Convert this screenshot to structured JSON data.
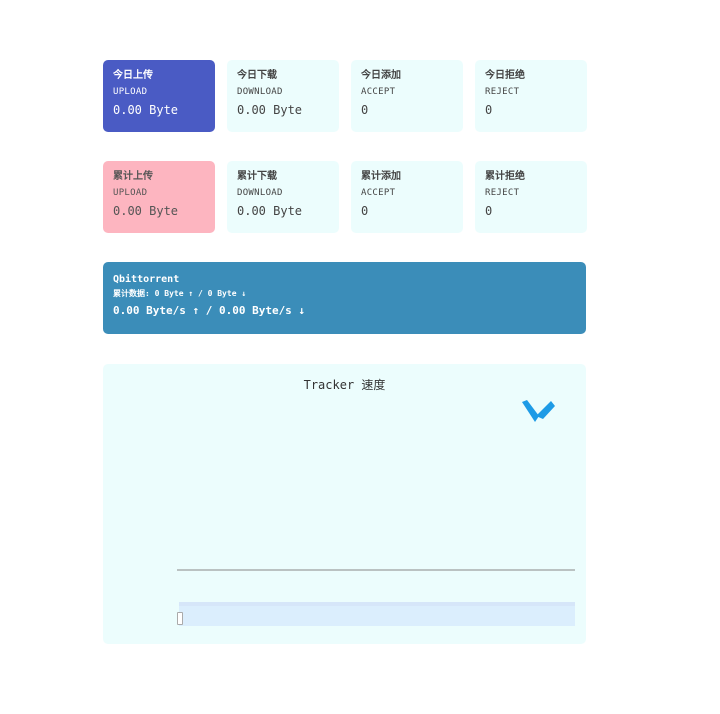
{
  "today": {
    "upload": {
      "title": "今日上传",
      "sub": "UPLOAD",
      "value": "0.00 Byte"
    },
    "download": {
      "title": "今日下载",
      "sub": "DOWNLOAD",
      "value": "0.00 Byte"
    },
    "accept": {
      "title": "今日添加",
      "sub": "ACCEPT",
      "value": "0"
    },
    "reject": {
      "title": "今日拒绝",
      "sub": "REJECT",
      "value": "0"
    }
  },
  "total": {
    "upload": {
      "title": "累计上传",
      "sub": "UPLOAD",
      "value": "0.00 Byte"
    },
    "download": {
      "title": "累计下载",
      "sub": "DOWNLOAD",
      "value": "0.00 Byte"
    },
    "accept": {
      "title": "累计添加",
      "sub": "ACCEPT",
      "value": "0"
    },
    "reject": {
      "title": "累计拒绝",
      "sub": "REJECT",
      "value": "0"
    }
  },
  "client": {
    "name": "Qbittorrent",
    "totals": "累计数据: 0 Byte ↑ / 0 Byte ↓",
    "speed": "0.00 Byte/s ↑ / 0.00 Byte/s ↓"
  },
  "chart": {
    "title": "Tracker 速度"
  },
  "colors": {
    "today_upload": "#4a5bc4",
    "total_upload": "#fdb5c0",
    "card_bg": "#ecfdfd",
    "client_bg": "#3b8db9",
    "logo": "#1e9be6"
  }
}
